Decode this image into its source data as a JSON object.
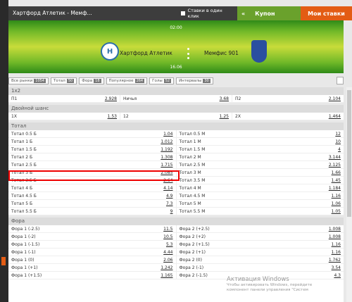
{
  "header": {
    "title": "Хартфорд Атлетик - Мемф...",
    "one_click": "Ставки в один клик",
    "coupon": "Купон",
    "my_bets": "Мои ставки"
  },
  "match": {
    "time": "02:00",
    "date": "16.06",
    "team1": "Хартфорд Атлетик",
    "team2": "Мемфис 901"
  },
  "filters": [
    {
      "label": "Все рынки",
      "count": "1054"
    },
    {
      "label": "Тотал",
      "count": "50"
    },
    {
      "label": "Фора",
      "count": "18"
    },
    {
      "label": "Популярное",
      "count": "264"
    },
    {
      "label": "Голы",
      "count": "52"
    },
    {
      "label": "Интервалы",
      "count": "30"
    }
  ],
  "markets": {
    "m1x2": {
      "title": "1x2",
      "rows": [
        [
          [
            "П1",
            "2.928"
          ],
          [
            "Ничья",
            "3.68"
          ],
          [
            "П2",
            "2.104"
          ]
        ]
      ]
    },
    "double": {
      "title": "Двойной шанс",
      "rows": [
        [
          [
            "1X",
            "1.53"
          ],
          [
            "12",
            "1.25"
          ],
          [
            "2X",
            "1.464"
          ]
        ]
      ]
    },
    "total": {
      "title": "Тотал",
      "rows": [
        [
          [
            "Тотал 0.5 Б",
            "1.04"
          ],
          [
            "Тотал 0.5 М",
            "12"
          ]
        ],
        [
          [
            "Тотал 1 Б",
            "1.012"
          ],
          [
            "Тотал 1 М",
            "10"
          ]
        ],
        [
          [
            "Тотал 1.5 Б",
            "1.192"
          ],
          [
            "Тотал 1.5 М",
            "4"
          ]
        ],
        [
          [
            "Тотал 2 Б",
            "1.308"
          ],
          [
            "Тотал 2 М",
            "3.144"
          ]
        ],
        [
          [
            "Тотал 2.5 Б",
            "1.715"
          ],
          [
            "Тотал 2.5 М",
            "2.125"
          ]
        ],
        [
          [
            "Тотал 3 Б",
            "2.085"
          ],
          [
            "Тотал 3 М",
            "1.66"
          ]
        ],
        [
          [
            "Тотал 3.5 Б",
            "2.64"
          ],
          [
            "Тотал 3.5 М",
            "1.45"
          ]
        ],
        [
          [
            "Тотал 4 Б",
            "4.14"
          ],
          [
            "Тотал 4 М",
            "1.184"
          ]
        ],
        [
          [
            "Тотал 4.5 Б",
            "4.9"
          ],
          [
            "Тотал 4.5 М",
            "1.16"
          ]
        ],
        [
          [
            "Тотал 5 Б",
            "7.3"
          ],
          [
            "Тотал 5 М",
            "1.06"
          ]
        ],
        [
          [
            "Тотал 5.5 Б",
            "9"
          ],
          [
            "Тотал 5.5 М",
            "1.05"
          ]
        ]
      ]
    },
    "handicap": {
      "title": "Фора",
      "rows": [
        [
          [
            "Фора 1 (-2.5)",
            "11.5"
          ],
          [
            "Фора 2 (+2.5)",
            "1.008"
          ]
        ],
        [
          [
            "Фора 1 (-2)",
            "10.5"
          ],
          [
            "Фора 2 (+2)",
            "1.008"
          ]
        ],
        [
          [
            "Фора 1 (-1.5)",
            "5.3"
          ],
          [
            "Фора 2 (+1.5)",
            "1.16"
          ]
        ],
        [
          [
            "Фора 1 (-1)",
            "4.44"
          ],
          [
            "Фора 2 (+1)",
            "1.16"
          ]
        ],
        [
          [
            "Фора 1 (0)",
            "2.06"
          ],
          [
            "Фора 2 (0)",
            "1.762"
          ]
        ],
        [
          [
            "Фора 1 (+1)",
            "1.242"
          ],
          [
            "Фора 2 (-1)",
            "3.54"
          ]
        ],
        [
          [
            "Фора 1 (+1.5)",
            "1.165"
          ],
          [
            "Фора 2 (-1.5)",
            "4.3"
          ]
        ]
      ]
    }
  },
  "watermark": {
    "title": "Активация Windows",
    "line1": "Чтобы активировать Windows, перейдите",
    "line2": "компонент панели управления \"Систем"
  }
}
